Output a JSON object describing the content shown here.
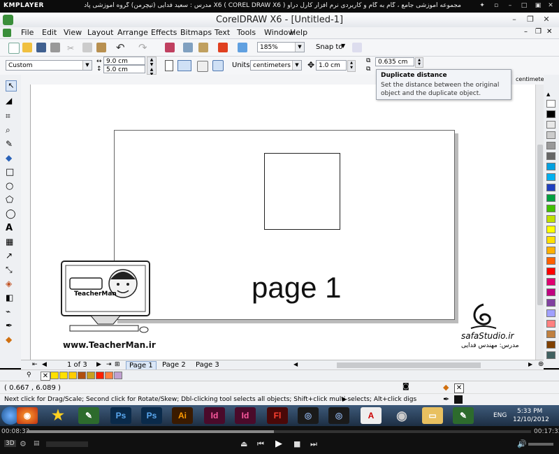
{
  "kmplayer": {
    "logo_text": "KMPLAYER",
    "title": "مجموعه آموزشی جامع ، گام به گام و کاربردی نرم افزار کارل دراو X6 ( COREL DRAW X6 )  مدرس : سعید فدایی (تیچرمن) گروه آموزشی پادشاه گرافیست ها",
    "time_elapsed": "00:08:32",
    "time_total": "00:17:32",
    "progress_fraction": 0.49
  },
  "app": {
    "title": "CorelDRAW X6 - [Untitled-1]"
  },
  "menu": [
    "File",
    "Edit",
    "View",
    "Layout",
    "Arrange",
    "Effects",
    "Bitmaps",
    "Text",
    "Tools",
    "Window",
    "Help"
  ],
  "toolbar1": {
    "zoom": "185%",
    "snap_to": "Snap to"
  },
  "toolbar2": {
    "page_size": "Custom",
    "width": "9.0 cm",
    "height": "5.0 cm",
    "units_label": "Units:",
    "units": "centimeters",
    "nudge": "1.0 cm",
    "duplicate_distance": "0.635 cm"
  },
  "tooltip": {
    "title": "Duplicate distance",
    "text": "Set the distance between the original object and the duplicate object."
  },
  "ruler": {
    "units": "centimeters"
  },
  "canvas": {
    "page_text": "page 1",
    "watermark_left": "www.TeacherMan.ir",
    "watermark_left_name": "TeacherMan",
    "watermark_right": "safaStudio.ir",
    "watermark_right_sub": "مدرس: مهندس فدایی"
  },
  "pages": {
    "counter": "1 of 3",
    "tabs": [
      "Page 1",
      "Page 2",
      "Page 3"
    ],
    "active_index": 0
  },
  "status": {
    "coords": "( 0.667 , 6.089 )",
    "hint": "Next click for Drag/Scale; Second click for Rotate/Skew; Dbl-clicking tool selects all objects; Shift+click multi-selects; Alt+click digs"
  },
  "taskbar": {
    "lang": "ENG",
    "time": "5:33 PM",
    "date": "12/10/2012"
  },
  "palette_colors": [
    "#ffffff",
    "#000000",
    "#e8e8e8",
    "#cccccc",
    "#999999",
    "#666666",
    "#00a0e0",
    "#00b0f0",
    "#2040c0",
    "#00a040",
    "#40c000",
    "#c0e000",
    "#ffff00",
    "#ffe000",
    "#ffb000",
    "#ff6000",
    "#ff0000",
    "#e00070",
    "#c00080",
    "#8040a0",
    "#a0a0ff",
    "#ff8080",
    "#c08040",
    "#804000",
    "#406060"
  ],
  "doc_palette_colors": [
    "#ffe000",
    "#ffe000",
    "#ffcc00",
    "#b05010",
    "#c8a020",
    "#ff2000",
    "#ff8040",
    "#c0a0d0"
  ]
}
